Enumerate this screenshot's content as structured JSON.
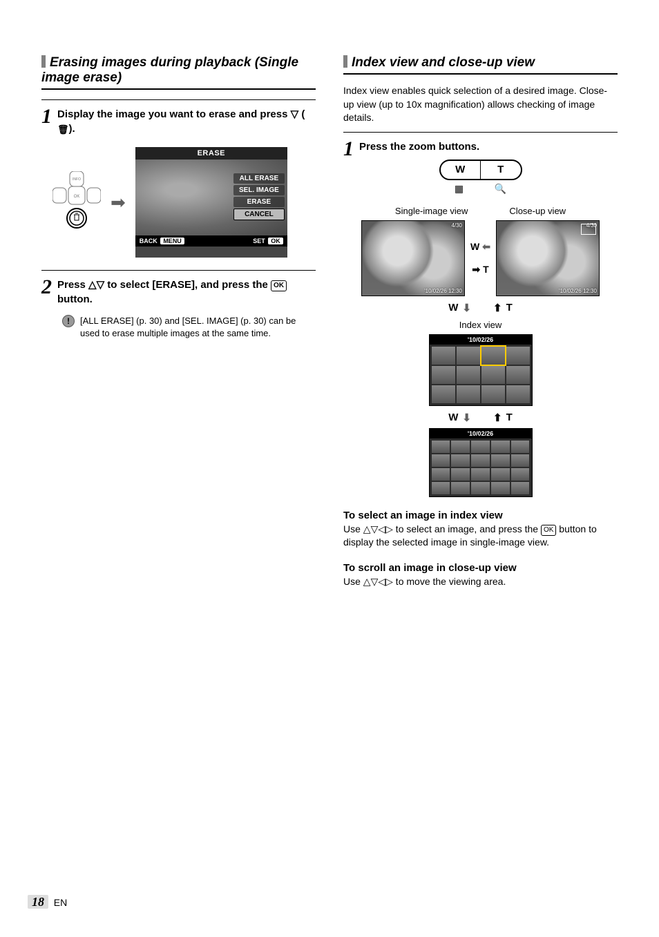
{
  "left": {
    "title": "Erasing images during playback (Single image erase)",
    "steps": [
      {
        "num": "1",
        "text_a": "Display the image you want to erase and press ",
        "text_b": " (",
        "text_c": ")."
      },
      {
        "num": "2",
        "text_a": "Press ",
        "text_b": " to select [ERASE], and press the ",
        "text_c": " button."
      }
    ],
    "dpad": {
      "top_label": "INFO",
      "center_label": "OK"
    },
    "erase_screen": {
      "title": "ERASE",
      "menu": [
        "ALL ERASE",
        "SEL. IMAGE",
        "ERASE",
        "CANCEL"
      ],
      "selected_index": 3,
      "back": "BACK",
      "back_btn": "MENU",
      "set": "SET",
      "set_btn": "OK"
    },
    "note": "[ALL ERASE] (p. 30) and [SEL. IMAGE] (p. 30) can be used to erase multiple images at the same time."
  },
  "right": {
    "title": "Index view and close-up view",
    "intro": "Index view enables quick selection of a desired image. Close-up view (up to 10x magnification) allows checking of image details.",
    "step1": {
      "num": "1",
      "text": "Press the zoom buttons."
    },
    "zoom": {
      "left": "W",
      "right": "T"
    },
    "view_labels": {
      "left": "Single-image view",
      "right": "Close-up view"
    },
    "thumb_overlay": {
      "count": "4/30",
      "datetime": "'10/02/26 12:30"
    },
    "wt_labels": {
      "w": "W",
      "t": "T"
    },
    "index_label": "Index view",
    "grid_date": "'10/02/26",
    "sub": [
      {
        "h": "To select an image in index view",
        "p_a": "Use ",
        "p_b": " to select an image, and press the ",
        "p_c": " button to display the selected image in single-image view."
      },
      {
        "h": "To scroll an image in close-up view",
        "p_a": "Use ",
        "p_b": " to move the viewing area."
      }
    ]
  },
  "page": {
    "num": "18",
    "lang": "EN"
  }
}
